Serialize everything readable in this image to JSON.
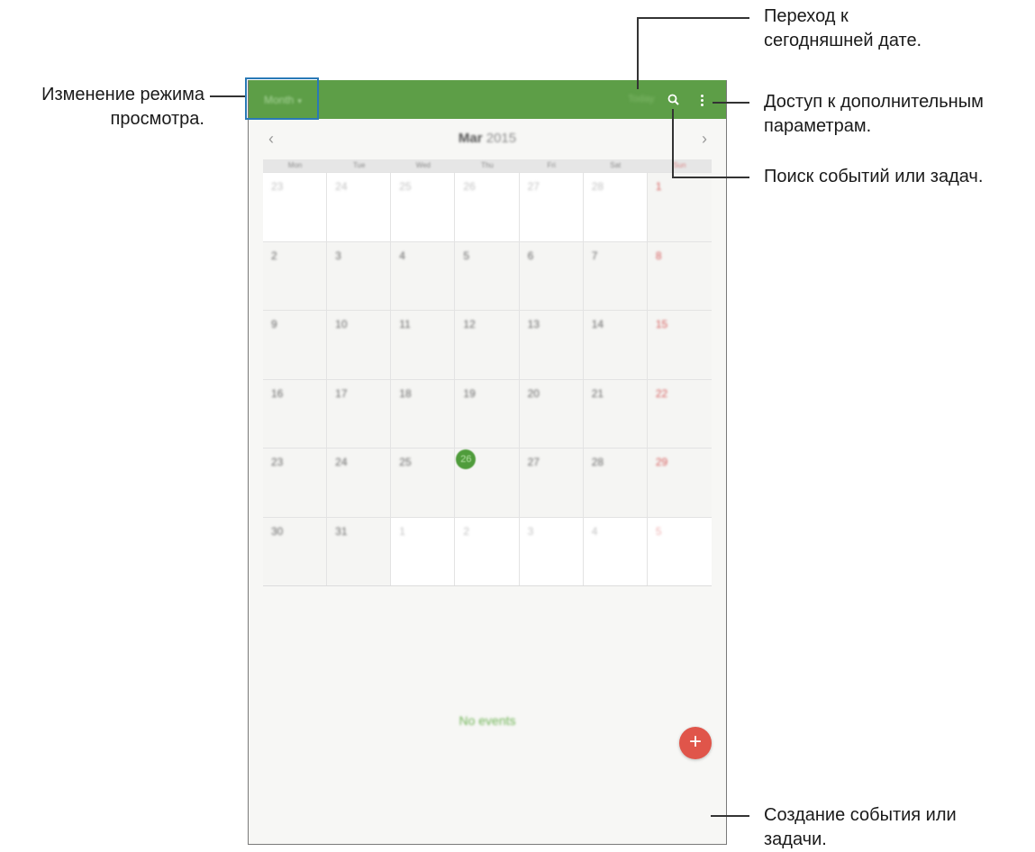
{
  "app": {
    "mode_label": "Month",
    "today_label": "Today",
    "month_name": "Mar",
    "year": "2015",
    "accent": "#5d9e47",
    "fab_color": "#e0554a",
    "icons": {
      "search": "search-icon",
      "more": "more-vert-icon",
      "prev": "chevron-left-icon",
      "next": "chevron-right-icon",
      "add": "plus-icon"
    }
  },
  "weekdays": [
    "Mon",
    "Tue",
    "Wed",
    "Thu",
    "Fri",
    "Sat",
    "Sun"
  ],
  "weeks": [
    [
      "23",
      "24",
      "25",
      "26",
      "27",
      "28",
      "1"
    ],
    [
      "2",
      "3",
      "4",
      "5",
      "6",
      "7",
      "8"
    ],
    [
      "9",
      "10",
      "11",
      "12",
      "13",
      "14",
      "15"
    ],
    [
      "16",
      "17",
      "18",
      "19",
      "20",
      "21",
      "22"
    ],
    [
      "23",
      "24",
      "25",
      "26",
      "27",
      "28",
      "29"
    ],
    [
      "30",
      "31",
      "1",
      "2",
      "3",
      "4",
      "5"
    ]
  ],
  "today": "26",
  "empty_state": "No events",
  "annotations": {
    "view_mode_line1": "Изменение режима",
    "view_mode_line2": "просмотра.",
    "today_line1": "Переход к",
    "today_line2": "сегодняшней дате.",
    "more_line1": "Доступ к дополнительным",
    "more_line2": "параметрам.",
    "search": "Поиск событий или задач.",
    "create_line1": "Создание события или",
    "create_line2": "задачи."
  }
}
